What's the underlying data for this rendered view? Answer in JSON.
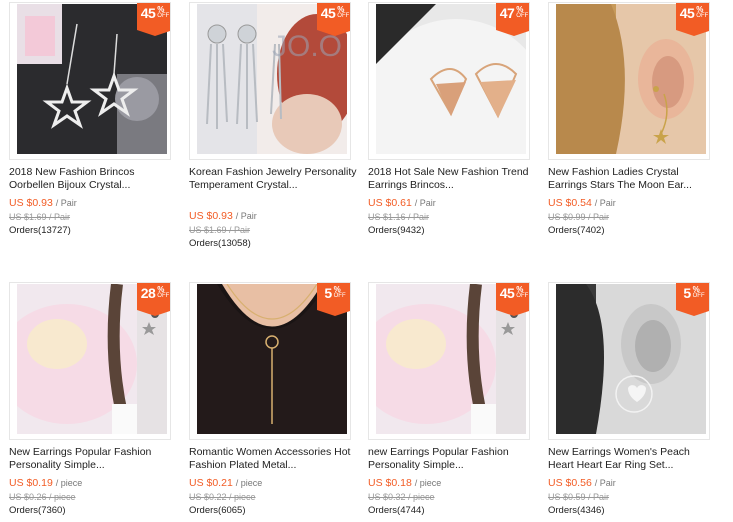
{
  "theme": {
    "accent": "#f25c25"
  },
  "products": [
    {
      "badge_num": "45",
      "badge_pct": "%",
      "badge_off": "OFF",
      "title": "2018 New Fashion Brincos Oorbellen Bijoux Crystal...",
      "price": "US $0.93",
      "unit": "/ Pair",
      "old_price": "US $1.69 / Pair",
      "orders": "Orders(13727)",
      "image": "star-drop-earrings-photo"
    },
    {
      "badge_num": "45",
      "badge_pct": "%",
      "badge_off": "OFF",
      "title": "Korean Fashion Jewelry Personality Temperament Crystal...",
      "price": "US $0.93",
      "unit": "/ Pair",
      "old_price": "US $1.69 / Pair",
      "orders": "Orders(13058)",
      "image": "crystal-tassel-earrings-photo"
    },
    {
      "badge_num": "47",
      "badge_pct": "%",
      "badge_off": "OFF",
      "title": "2018 Hot Sale New Fashion Trend Earrings Brincos...",
      "price": "US $0.61",
      "unit": "/ Pair",
      "old_price": "US $1.16 / Pair",
      "orders": "Orders(9432)",
      "image": "gold-v-hoop-earrings-photo"
    },
    {
      "badge_num": "45",
      "badge_pct": "%",
      "badge_off": "OFF",
      "title": "New Fashion Ladies Crystal Earrings Stars The Moon Ear...",
      "price": "US $0.54",
      "unit": "/ Pair",
      "old_price": "US $0.99 / Pair",
      "orders": "Orders(7402)",
      "image": "moon-star-earrings-photo"
    },
    {
      "badge_num": "28",
      "badge_pct": "%",
      "badge_off": "OFF",
      "title": "New Earrings Popular Fashion Personality Simple...",
      "price": "US $0.19",
      "unit": "/ piece",
      "old_price": "US $0.26 / piece",
      "orders": "Orders(7360)",
      "image": "braid-star-earring-photo"
    },
    {
      "badge_num": "5",
      "badge_pct": "%",
      "badge_off": "OFF",
      "title": "Romantic Women Accessories Hot Fashion Plated Metal...",
      "price": "US $0.21",
      "unit": "/ piece",
      "old_price": "US $0.22 / piece",
      "orders": "Orders(6065)",
      "image": "circle-lariat-necklace-photo"
    },
    {
      "badge_num": "45",
      "badge_pct": "%",
      "badge_off": "OFF",
      "title": "new Earrings Popular Fashion Personality Simple...",
      "price": "US $0.18",
      "unit": "/ piece",
      "old_price": "US $0.32 / piece",
      "orders": "Orders(4744)",
      "image": "braid-star-earring-photo"
    },
    {
      "badge_num": "5",
      "badge_pct": "%",
      "badge_off": "OFF",
      "title": "New Earrings Women's Peach Heart Heart Ear Ring Set...",
      "price": "US $0.56",
      "unit": "/ Pair",
      "old_price": "US $0.59 / Pair",
      "orders": "Orders(4346)",
      "image": "heart-hoop-earring-photo"
    }
  ]
}
